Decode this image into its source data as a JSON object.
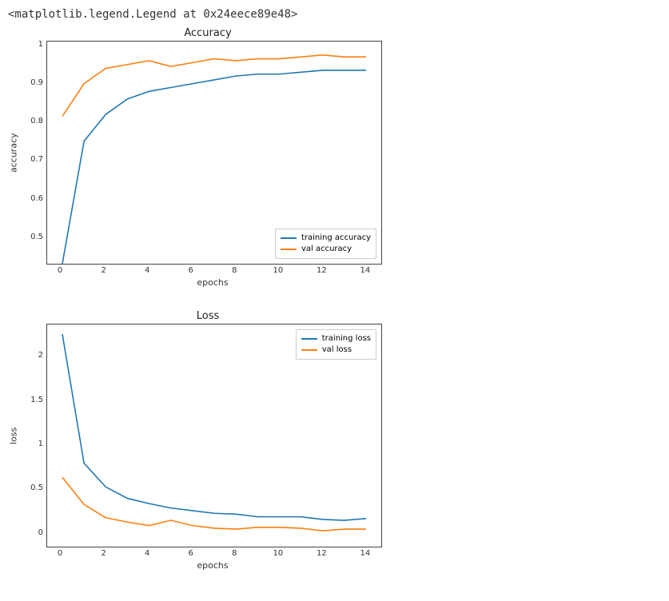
{
  "repr_line": "<matplotlib.legend.Legend at 0x24eece89e48>",
  "chart_data": [
    {
      "type": "line",
      "title": "Accuracy",
      "xlabel": "epochs",
      "ylabel": "accuracy",
      "x": [
        0,
        1,
        2,
        3,
        4,
        5,
        6,
        7,
        8,
        9,
        10,
        11,
        12,
        13,
        14
      ],
      "xticks": [
        0,
        2,
        4,
        6,
        8,
        10,
        12,
        14
      ],
      "yticks": [
        0.5,
        0.6,
        0.7,
        0.8,
        0.9,
        1.0
      ],
      "ylim": [
        0.44,
        1.02
      ],
      "xlim": [
        -0.7,
        14.7
      ],
      "legend_pos": "bottom-right",
      "series": [
        {
          "name": "training accuracy",
          "color": "#1f77b4",
          "values": [
            0.44,
            0.76,
            0.83,
            0.87,
            0.89,
            0.9,
            0.91,
            0.92,
            0.93,
            0.935,
            0.935,
            0.94,
            0.945,
            0.945,
            0.945
          ]
        },
        {
          "name": "val accuracy",
          "color": "#ff7f0e",
          "values": [
            0.825,
            0.91,
            0.95,
            0.96,
            0.97,
            0.955,
            0.965,
            0.975,
            0.97,
            0.975,
            0.975,
            0.98,
            0.985,
            0.98,
            0.98
          ]
        }
      ]
    },
    {
      "type": "line",
      "title": "Loss",
      "xlabel": "epochs",
      "ylabel": "loss",
      "x": [
        0,
        1,
        2,
        3,
        4,
        5,
        6,
        7,
        8,
        9,
        10,
        11,
        12,
        13,
        14
      ],
      "xticks": [
        0,
        2,
        4,
        6,
        8,
        10,
        12,
        14
      ],
      "yticks": [
        0.0,
        0.5,
        1.0,
        1.5,
        2.0
      ],
      "ylim": [
        -0.12,
        2.41
      ],
      "xlim": [
        -0.7,
        14.7
      ],
      "legend_pos": "top-right",
      "series": [
        {
          "name": "training loss",
          "color": "#1f77b4",
          "values": [
            2.3,
            0.83,
            0.56,
            0.43,
            0.37,
            0.32,
            0.29,
            0.26,
            0.25,
            0.22,
            0.22,
            0.22,
            0.19,
            0.18,
            0.2
          ]
        },
        {
          "name": "val loss",
          "color": "#ff7f0e",
          "values": [
            0.67,
            0.36,
            0.21,
            0.16,
            0.12,
            0.18,
            0.12,
            0.09,
            0.08,
            0.1,
            0.1,
            0.09,
            0.06,
            0.08,
            0.08
          ]
        }
      ]
    }
  ]
}
